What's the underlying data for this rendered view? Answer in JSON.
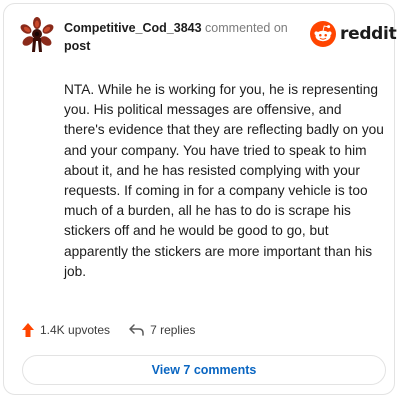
{
  "comment": {
    "username": "Competitive_Cod_3843",
    "action_text": "commented on",
    "post_link": "post",
    "brand": "reddit",
    "body": "NTA. While he is working for you, he is representing you. His political messages are offensive, and there's evidence that they are reflecting badly on you and your company. You have tried to speak to him about it, and he has resisted complying with your requests. If coming in for a company vehicle is too much of a burden, all he has to do is scrape his stickers off and he would be good to go, but apparently the stickers are more important than his job.",
    "upvotes": "1.4K upvotes",
    "replies": "7 replies",
    "view_button": "View 7 comments"
  },
  "icons": {
    "avatar": "avatar-icon",
    "logo": "reddit-logo-icon",
    "upvote": "upvote-arrow-icon",
    "reply": "reply-arrow-icon"
  },
  "colors": {
    "upvote": "#ff4500",
    "reddit_orange": "#ff4500",
    "link_button": "#0a66c2"
  }
}
